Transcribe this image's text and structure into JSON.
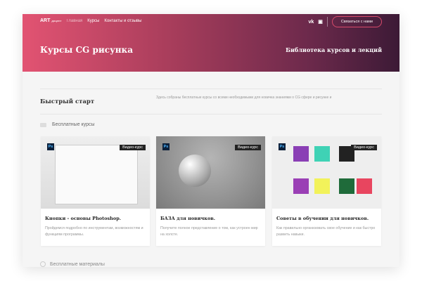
{
  "header": {
    "logo": "ART",
    "logo_sub": "доцент",
    "nav": [
      "Главная",
      "Курсы",
      "Контакты и отзывы"
    ],
    "social": [
      "vk-icon",
      "chat-icon"
    ],
    "contact_button": "Связаться с нами",
    "title": "Курсы CG рисунка",
    "subtitle": "Библиотека курсов и лекций"
  },
  "quick_start": {
    "title": "Быстрый старт",
    "description": "Здесь собраны бесплатные курсы со всеми необходимыми для новичка знаниями о CG сфере и рисунке и"
  },
  "section_free_courses": "Бесплатные курсы",
  "cards": [
    {
      "app": "Ps",
      "badge": "Видео-курс",
      "title": "Кнопки - основы Photoshop.",
      "desc": "Пройдемся подробно по инструментам, возможностям и функциям программы."
    },
    {
      "app": "Ps",
      "badge": "Видео-курс",
      "title": "БАЗА для новичков.",
      "desc": "Получите полное представление о том, как устроен мир на холсте."
    },
    {
      "app": "Ps",
      "badge": "Видео-курс",
      "title": "Советы в обучении для новичков.",
      "desc": "Как правильно организовать свое обучение и как быстро развить навыки."
    }
  ],
  "section_free_materials": "Бесплатные материалы"
}
